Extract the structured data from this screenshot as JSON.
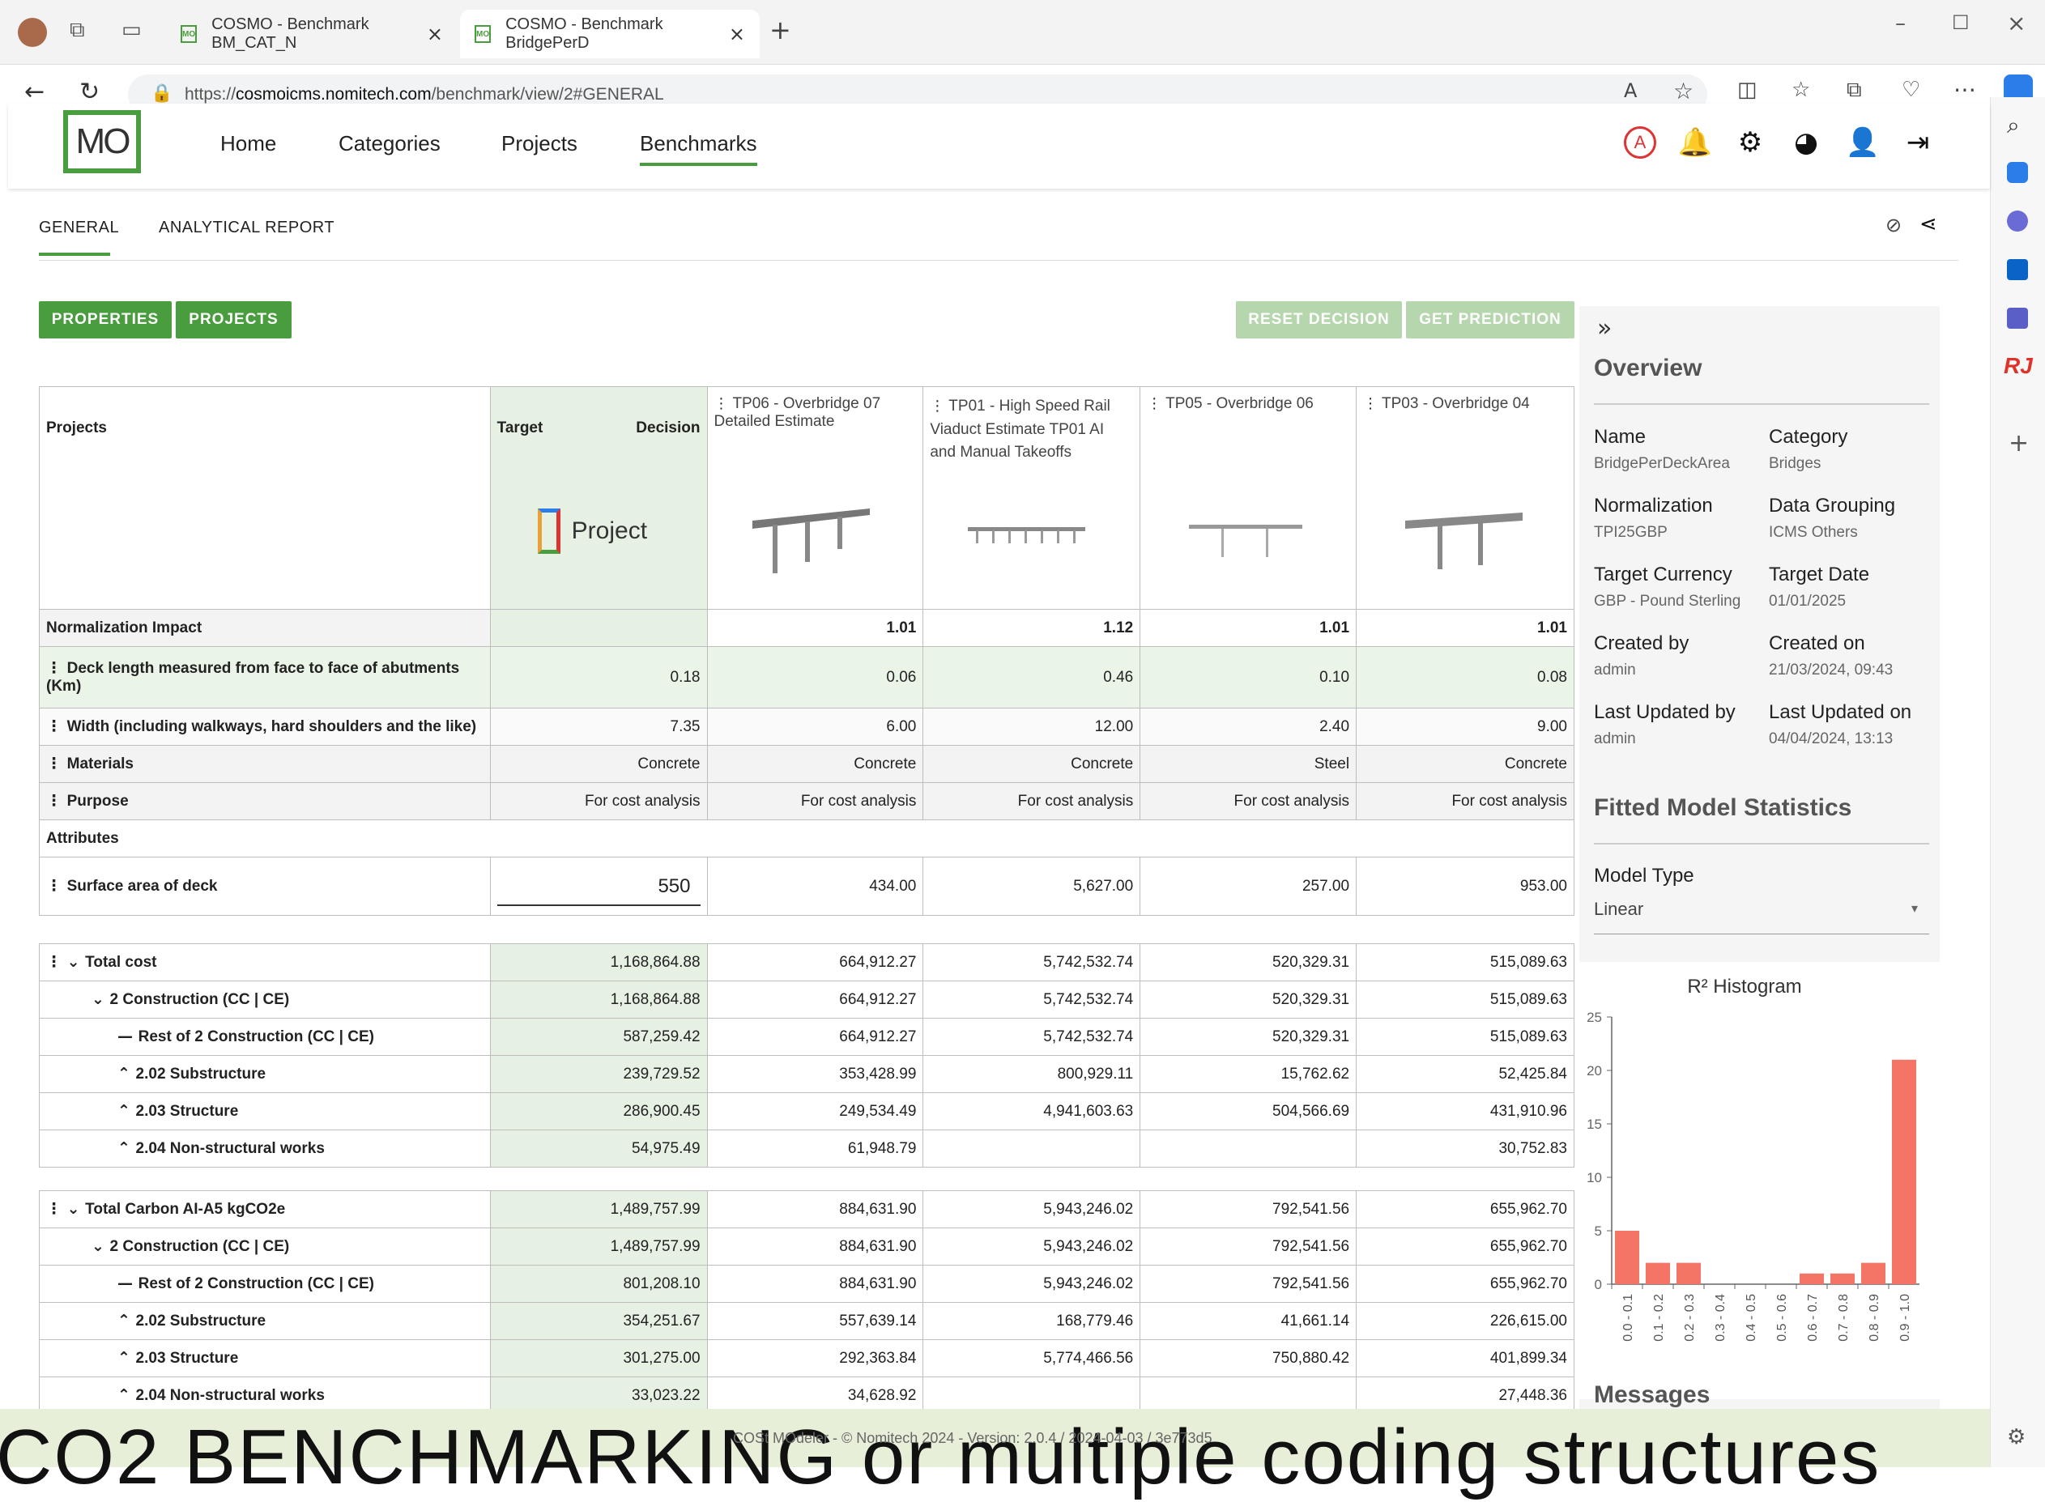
{
  "browser": {
    "tabs": [
      {
        "title": "COSMO - Benchmark BM_CAT_N"
      },
      {
        "title": "COSMO - Benchmark BridgePerD"
      }
    ],
    "url_prefix": "https://",
    "url_domain": "cosmoicms.nomitech.com",
    "url_path": "/benchmark/view/2#GENERAL"
  },
  "header": {
    "logo": "MO",
    "nav": [
      "Home",
      "Categories",
      "Projects",
      "Benchmarks"
    ],
    "avatar_letter": "A"
  },
  "subtabs": [
    "GENERAL",
    "ANALYTICAL REPORT"
  ],
  "buttons": {
    "properties": "PROPERTIES",
    "projects": "PROJECTS",
    "reset": "RESET DECISION",
    "predict": "GET PREDICTION"
  },
  "table": {
    "header": {
      "projects": "Projects",
      "target": "Target",
      "decision": "Decision",
      "target_image_label": "Project",
      "cols": [
        "TP06 - Overbridge 07 Detailed Estimate",
        "TP01 - High Speed Rail Viaduct Estimate TP01 AI and Manual Takeoffs",
        "TP05 - Overbridge 06",
        "TP03 - Overbridge 04"
      ]
    },
    "rows": [
      {
        "label": "Normalization Impact",
        "target": "",
        "vals": [
          "1.01",
          "1.12",
          "1.01",
          "1.01"
        ]
      },
      {
        "label": "Deck length measured from face to face of abutments (Km)",
        "target": "0.18",
        "vals": [
          "0.06",
          "0.46",
          "0.10",
          "0.08"
        ]
      },
      {
        "label": "Width (including walkways, hard shoulders and the like)",
        "target": "7.35",
        "vals": [
          "6.00",
          "12.00",
          "2.40",
          "9.00"
        ]
      },
      {
        "label": "Materials",
        "target": "Concrete",
        "vals": [
          "Concrete",
          "Concrete",
          "Steel",
          "Concrete"
        ]
      },
      {
        "label": "Purpose",
        "target": "For cost analysis",
        "vals": [
          "For cost analysis",
          "For cost analysis",
          "For cost analysis",
          "For cost analysis"
        ]
      },
      {
        "label": "Attributes",
        "target": "",
        "vals": [
          "",
          "",
          "",
          ""
        ]
      },
      {
        "label": "Surface area of deck",
        "target": "550",
        "vals": [
          "434.00",
          "5,627.00",
          "257.00",
          "953.00"
        ]
      }
    ],
    "cost": [
      {
        "label": "Total cost",
        "target": "1,168,864.88",
        "vals": [
          "664,912.27",
          "5,742,532.74",
          "520,329.31",
          "515,089.63"
        ]
      },
      {
        "label": "2 Construction (CC | CE)",
        "target": "1,168,864.88",
        "vals": [
          "664,912.27",
          "5,742,532.74",
          "520,329.31",
          "515,089.63"
        ]
      },
      {
        "label": "Rest of 2 Construction (CC | CE)",
        "target": "587,259.42",
        "vals": [
          "664,912.27",
          "5,742,532.74",
          "520,329.31",
          "515,089.63"
        ]
      },
      {
        "label": "2.02 Substructure",
        "target": "239,729.52",
        "vals": [
          "353,428.99",
          "800,929.11",
          "15,762.62",
          "52,425.84"
        ]
      },
      {
        "label": "2.03 Structure",
        "target": "286,900.45",
        "vals": [
          "249,534.49",
          "4,941,603.63",
          "504,566.69",
          "431,910.96"
        ]
      },
      {
        "label": "2.04 Non-structural works",
        "target": "54,975.49",
        "vals": [
          "61,948.79",
          "",
          "",
          "30,752.83"
        ]
      }
    ],
    "carbon": [
      {
        "label": "Total Carbon AI-A5 kgCO2e",
        "target": "1,489,757.99",
        "vals": [
          "884,631.90",
          "5,943,246.02",
          "792,541.56",
          "655,962.70"
        ]
      },
      {
        "label": "2 Construction (CC | CE)",
        "target": "1,489,757.99",
        "vals": [
          "884,631.90",
          "5,943,246.02",
          "792,541.56",
          "655,962.70"
        ]
      },
      {
        "label": "Rest of 2 Construction (CC | CE)",
        "target": "801,208.10",
        "vals": [
          "884,631.90",
          "5,943,246.02",
          "792,541.56",
          "655,962.70"
        ]
      },
      {
        "label": "2.02 Substructure",
        "target": "354,251.67",
        "vals": [
          "557,639.14",
          "168,779.46",
          "41,661.14",
          "226,615.00"
        ]
      },
      {
        "label": "2.03 Structure",
        "target": "301,275.00",
        "vals": [
          "292,363.84",
          "5,774,466.56",
          "750,880.42",
          "401,899.34"
        ]
      },
      {
        "label": "2.04 Non-structural works",
        "target": "33,023.22",
        "vals": [
          "34,628.92",
          "",
          "",
          "27,448.36"
        ]
      }
    ]
  },
  "overview": {
    "title": "Overview",
    "fields": [
      {
        "label": "Name",
        "value": "BridgePerDeckArea"
      },
      {
        "label": "Category",
        "value": "Bridges"
      },
      {
        "label": "Normalization",
        "value": "TPI25GBP"
      },
      {
        "label": "Data Grouping",
        "value": "ICMS Others"
      },
      {
        "label": "Target Currency",
        "value": "GBP - Pound Sterling"
      },
      {
        "label": "Target Date",
        "value": "01/01/2025"
      },
      {
        "label": "Created by",
        "value": "admin"
      },
      {
        "label": "Created on",
        "value": "21/03/2024, 09:43"
      },
      {
        "label": "Last Updated by",
        "value": "admin"
      },
      {
        "label": "Last Updated on",
        "value": "04/04/2024, 13:13"
      }
    ],
    "stats_title": "Fitted Model Statistics",
    "model_type_label": "Model Type",
    "model_type_value": "Linear",
    "messages_title": "Messages"
  },
  "chart_data": {
    "type": "bar",
    "title": "R² Histogram",
    "categories": [
      "0.0 - 0.1",
      "0.1 - 0.2",
      "0.2 - 0.3",
      "0.3 - 0.4",
      "0.4 - 0.5",
      "0.5 - 0.6",
      "0.6 - 0.7",
      "0.7 - 0.8",
      "0.8 - 0.9",
      "0.9 - 1.0"
    ],
    "values": [
      5,
      2,
      2,
      0,
      0,
      0,
      1,
      1,
      2,
      21
    ],
    "ylim": [
      0,
      25
    ],
    "yticks": [
      0,
      5,
      10,
      15,
      20,
      25
    ],
    "color": "#f47466"
  },
  "footer": {
    "version": "COSt MOdeler - © Nomitech 2024 - Version: 2.0.4 / 2024-04-03 / 3e773d5",
    "banner": "CO2 BENCHMARKING or multiple coding structures"
  },
  "colors": {
    "accent": "#4a9d3e",
    "target_bg": "#e7f1e3",
    "bar": "#f47466"
  }
}
